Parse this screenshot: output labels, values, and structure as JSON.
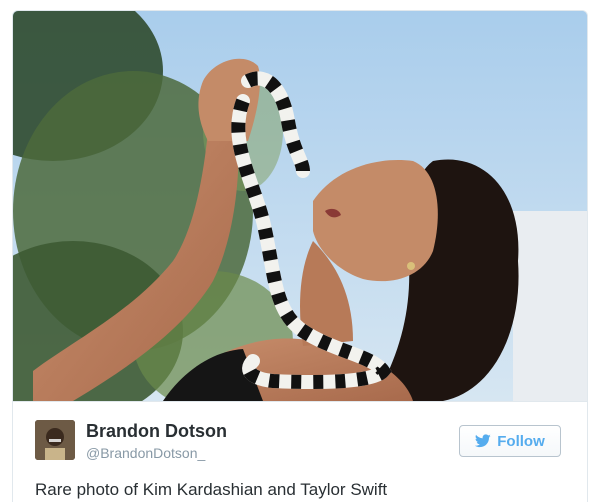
{
  "tweet": {
    "author": {
      "display_name": "Brandon Dotson",
      "handle": "@BrandonDotson_"
    },
    "follow_button": {
      "label": "Follow",
      "icon": "twitter-bird-icon"
    },
    "text": "Rare photo of Kim Kardashian and Taylor Swift"
  },
  "colors": {
    "accent": "#55acee",
    "text": "#292f33",
    "muted": "#8899a6",
    "border": "#e1e8ed"
  }
}
